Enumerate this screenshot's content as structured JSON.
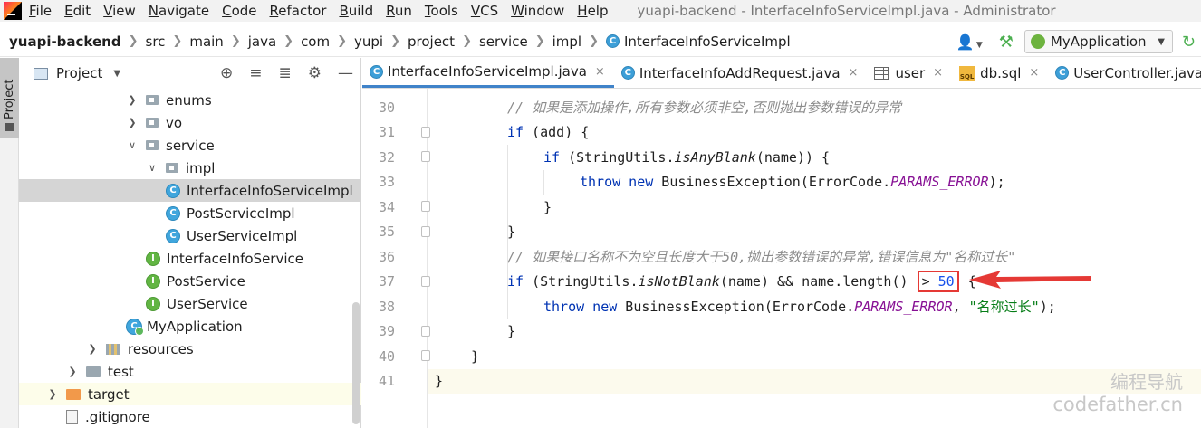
{
  "menu": {
    "items": [
      "File",
      "Edit",
      "View",
      "Navigate",
      "Code",
      "Refactor",
      "Build",
      "Run",
      "Tools",
      "VCS",
      "Window",
      "Help"
    ],
    "window_title": "yuapi-backend - InterfaceInfoServiceImpl.java - Administrator"
  },
  "breadcrumbs": [
    "yuapi-backend",
    "src",
    "main",
    "java",
    "com",
    "yupi",
    "project",
    "service",
    "impl",
    "InterfaceInfoServiceImpl"
  ],
  "toolbar": {
    "run_config": "MyApplication",
    "icons": [
      "user-icon",
      "build-hammer-icon",
      "spring-boot-icon",
      "refresh-icon"
    ]
  },
  "left_stripe": {
    "project_tab": "Project"
  },
  "project_panel": {
    "title": "Project",
    "tools": [
      "locate-icon",
      "expand-all-icon",
      "collapse-all-icon",
      "settings-icon",
      "hide-icon"
    ],
    "tree": [
      {
        "label": "enums",
        "icon": "package",
        "arrow": "right"
      },
      {
        "label": "vo",
        "icon": "package",
        "arrow": "right"
      },
      {
        "label": "service",
        "icon": "package",
        "arrow": "down"
      },
      {
        "label": "impl",
        "icon": "package",
        "arrow": "down"
      },
      {
        "label": "InterfaceInfoServiceImpl",
        "icon": "class",
        "arrow": "none",
        "selected": true
      },
      {
        "label": "PostServiceImpl",
        "icon": "class",
        "arrow": "none"
      },
      {
        "label": "UserServiceImpl",
        "icon": "class",
        "arrow": "none"
      },
      {
        "label": "InterfaceInfoService",
        "icon": "interface",
        "arrow": "none"
      },
      {
        "label": "PostService",
        "icon": "interface",
        "arrow": "none"
      },
      {
        "label": "UserService",
        "icon": "interface",
        "arrow": "none"
      },
      {
        "label": "MyApplication",
        "icon": "app",
        "arrow": "none"
      },
      {
        "label": "resources",
        "icon": "resources",
        "arrow": "right"
      },
      {
        "label": "test",
        "icon": "folder",
        "arrow": "right"
      },
      {
        "label": "target",
        "icon": "folder-orange",
        "arrow": "right",
        "excluded": true
      },
      {
        "label": ".gitignore",
        "icon": "file",
        "arrow": "none"
      }
    ]
  },
  "tabs": [
    {
      "label": "InterfaceInfoServiceImpl.java",
      "icon": "class",
      "active": true
    },
    {
      "label": "InterfaceInfoAddRequest.java",
      "icon": "class",
      "active": false
    },
    {
      "label": "user",
      "icon": "table",
      "active": false
    },
    {
      "label": "db.sql",
      "icon": "sql",
      "active": false
    },
    {
      "label": "UserController.java",
      "icon": "class",
      "active": false
    }
  ],
  "tab_close_glyph": "×",
  "editor": {
    "lines": [
      {
        "n": "30",
        "indent": 1,
        "parts": [
          {
            "t": "// 如果是添加操作,所有参数必须非空,否则抛出参数错误的异常",
            "c": "cm"
          }
        ]
      },
      {
        "n": "31",
        "indent": 1,
        "fold": true,
        "parts": [
          {
            "t": "if",
            "c": "kw"
          },
          {
            "t": " (add) {",
            "c": ""
          }
        ]
      },
      {
        "n": "32",
        "indent": 2,
        "fold": true,
        "parts": [
          {
            "t": "if",
            "c": "kw"
          },
          {
            "t": " (StringUtils.",
            "c": ""
          },
          {
            "t": "isAnyBlank",
            "c": "sm"
          },
          {
            "t": "(name)) {",
            "c": ""
          }
        ]
      },
      {
        "n": "33",
        "indent": 3,
        "parts": [
          {
            "t": "throw new",
            "c": "kw"
          },
          {
            "t": " BusinessException(ErrorCode.",
            "c": ""
          },
          {
            "t": "PARAMS_ERROR",
            "c": "cst"
          },
          {
            "t": ");",
            "c": ""
          }
        ]
      },
      {
        "n": "34",
        "indent": 2,
        "fold": true,
        "parts": [
          {
            "t": "}",
            "c": ""
          }
        ]
      },
      {
        "n": "35",
        "indent": 1,
        "fold": true,
        "parts": [
          {
            "t": "}",
            "c": ""
          }
        ]
      },
      {
        "n": "36",
        "indent": 1,
        "parts": [
          {
            "t": "// 如果接口名称不为空且长度大于50,抛出参数错误的异常,错误信息为\"名称过长\"",
            "c": "cm"
          }
        ]
      },
      {
        "n": "37",
        "indent": 1,
        "fold": true,
        "parts": [
          {
            "t": "if",
            "c": "kw"
          },
          {
            "t": " (StringUtils.",
            "c": ""
          },
          {
            "t": "isNotBlank",
            "c": "sm"
          },
          {
            "t": "(name) && name.length() ",
            "c": ""
          },
          {
            "t": "> ",
            "c": "box"
          },
          {
            "t": "50",
            "c": "boxnum"
          },
          {
            "t": " {",
            "c": ""
          }
        ]
      },
      {
        "n": "38",
        "indent": 2,
        "parts": [
          {
            "t": "throw new",
            "c": "kw"
          },
          {
            "t": " BusinessException(ErrorCode.",
            "c": ""
          },
          {
            "t": "PARAMS_ERROR",
            "c": "cst"
          },
          {
            "t": ", ",
            "c": ""
          },
          {
            "t": "\"名称过长\"",
            "c": "str"
          },
          {
            "t": ");",
            "c": ""
          }
        ]
      },
      {
        "n": "39",
        "indent": 1,
        "fold": true,
        "parts": [
          {
            "t": "}",
            "c": ""
          }
        ]
      },
      {
        "n": "40",
        "indent": 0,
        "fold": true,
        "parts": [
          {
            "t": "}",
            "c": ""
          }
        ]
      },
      {
        "n": "41",
        "indent": -1,
        "current": true,
        "parts": [
          {
            "t": "}",
            "c": ""
          }
        ]
      }
    ]
  },
  "annotation": {
    "arrow_color": "#e53935",
    "box_color": "#e53935"
  },
  "watermark": {
    "line1": "编程导航",
    "line2": "codefather.cn"
  }
}
